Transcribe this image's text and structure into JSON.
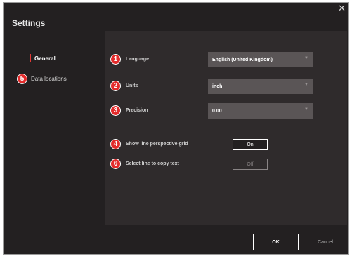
{
  "window": {
    "title": "Settings",
    "close_glyph": "✕"
  },
  "sidebar": {
    "items": [
      {
        "label": "General",
        "selected": true
      },
      {
        "label": "Data locations",
        "badge": "5"
      }
    ]
  },
  "general": {
    "language": {
      "badge": "1",
      "label": "Language",
      "value": "English (United Kingdom)"
    },
    "units": {
      "badge": "2",
      "label": "Units",
      "value": "inch"
    },
    "precision": {
      "badge": "3",
      "label": "Precision",
      "value": "0.00"
    },
    "perspective_grid": {
      "badge": "4",
      "label": "Show line perspective grid",
      "state": "On"
    },
    "copy_text": {
      "badge": "6",
      "label": "Select line to copy text",
      "state": "Off"
    }
  },
  "footer": {
    "ok_label": "OK",
    "cancel_label": "Cancel"
  },
  "colors": {
    "window_bg": "#232021",
    "panel_bg": "#2f2b2c",
    "dropdown_bg": "#5a5556",
    "badge_red": "#e32b2b",
    "selection_marker": "#e53935"
  },
  "icons": {
    "close": "close-icon",
    "dropdown": "chevron-down-icon"
  }
}
